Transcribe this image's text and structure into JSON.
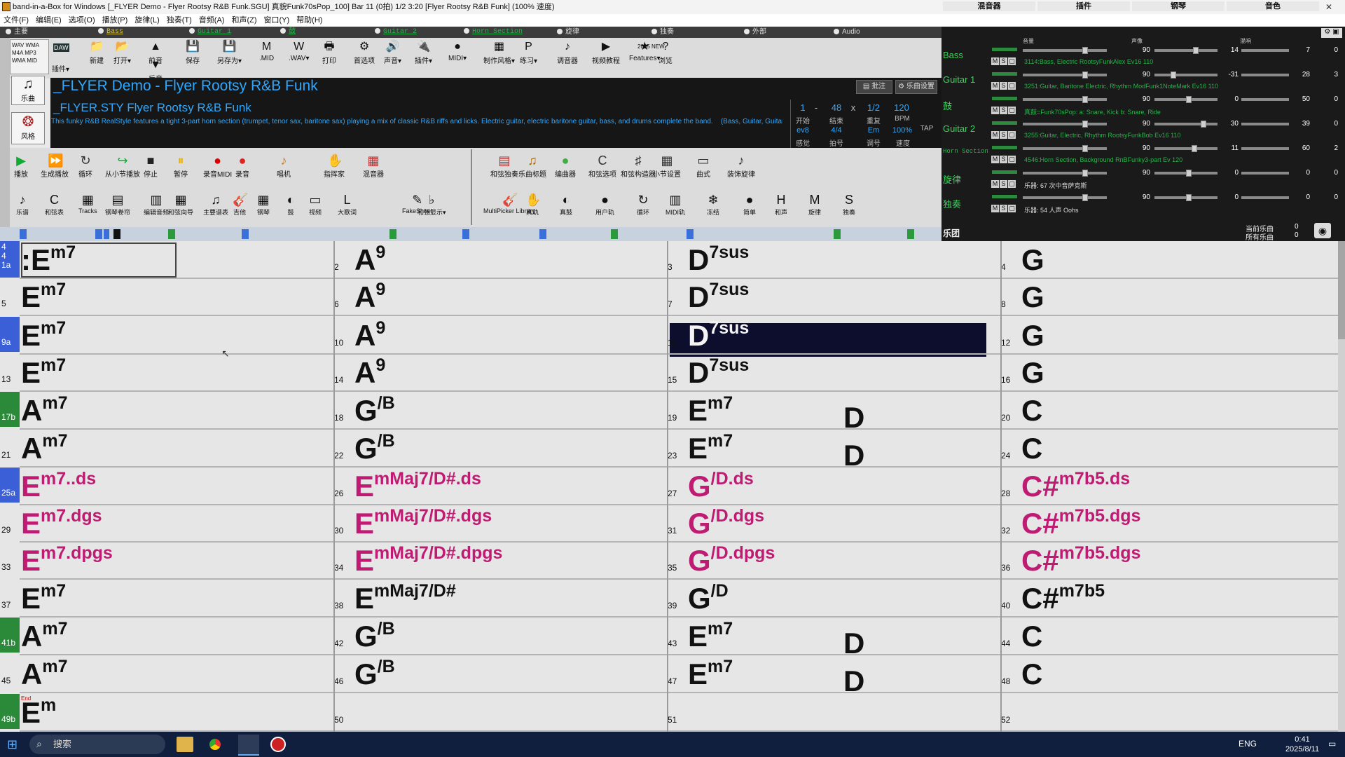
{
  "window": {
    "title": "band-in-a-Box for Windows  [_FLYER Demo - Flyer Rootsy R&B Funk.SGU] 真貌Funk70sPop_100] Bar 11 (0拍) 1/2  3:20 [Flyer Rootsy R&B Funk] (100% 速度)",
    "minimize": "—",
    "maximize": "□",
    "close": "✕"
  },
  "menu": [
    "文件(F)",
    "编辑(E)",
    "选项(O)",
    "播放(P)",
    "旋律(L)",
    "独奏(T)",
    "音频(A)",
    "和声(Z)",
    "窗口(Y)",
    "帮助(H)"
  ],
  "tracks": [
    {
      "label": "主要",
      "mono": false
    },
    {
      "label": "Bass",
      "mono": true,
      "yellow": true
    },
    {
      "label": "Guitar 1",
      "mono": true
    },
    {
      "label": "鼓",
      "mono": true
    },
    {
      "label": "Guitar 2",
      "mono": true
    },
    {
      "label": "Horn Section",
      "mono": true
    },
    {
      "label": "旋律",
      "mono": false
    },
    {
      "label": "独奏",
      "mono": false
    },
    {
      "label": "外部",
      "mono": false
    },
    {
      "label": "Audio",
      "mono": false
    }
  ],
  "toolbar1": {
    "buttons": [
      "新建",
      "打开▾",
      "前音",
      "后音",
      "保存",
      "另存为▾",
      ".MID",
      ".WAV▾",
      "打印",
      "首选项",
      "声音▾",
      "插件▾",
      "MIDI▾",
      "制作风格▾",
      "练习▾",
      "调音器",
      "视频教程",
      "Features▾",
      "浏览"
    ],
    "new_badge": "2025 NEW",
    "daw": "DAW",
    "plugin": "插件▾"
  },
  "side_labels": {
    "songs": "乐曲",
    "styles": "风格"
  },
  "song": {
    "title": "_FLYER Demo - Flyer Rootsy R&B Funk",
    "style": "_FLYER.STY Flyer Rootsy R&B Funk",
    "description": "This funky R&B RealStyle features a tight 3-part horn section (trumpet, tenor sax, baritone sax) playing a mix of classic R&B riffs and licks. Electric guitar, electric baritone guitar, bass, and drums complete the band.",
    "instruments": "(Bass, Guitar, Guitar, Horn Se",
    "notes_btn": "批注",
    "settings_btn": "乐曲设置"
  },
  "info": {
    "start": "1",
    "end": "48",
    "times": "1/2",
    "bpm": "120",
    "loop": "ev8",
    "meter": "4/4",
    "key": "Em",
    "speed": "100%",
    "lab_start": "开始",
    "lab_end": "结束",
    "lab_repeat": "重复",
    "lab_bpm": "BPM",
    "lab_tap": "TAP",
    "lab_feel": "感觉",
    "lab_meter": "拍号",
    "lab_key": "调号",
    "lab_speed": "速度",
    "dash": "-",
    "x": "x"
  },
  "toolbar2": [
    "播放",
    "生成播放",
    "循环",
    "从小节播放",
    "停止",
    "暂停",
    "录音MIDI",
    "录音",
    "唱机",
    "指挥家",
    "混音器",
    "和弦独奏",
    "乐曲标题",
    "编曲器",
    "和弦选项",
    "和弦构造器",
    "小节设置",
    "曲式",
    "装饰旋律"
  ],
  "toolbar3": [
    "乐谱",
    "和弦表",
    "Tracks",
    "钢琴卷帘",
    "编辑音频",
    "和弦向导",
    "主要谱表",
    "吉他",
    "钢琴",
    "鼓",
    "视频",
    "大歌词",
    "FakeSheet",
    "和弦显示▾",
    "MultiPicker Library",
    "真轨",
    "真鼓",
    "用户轨",
    "循环",
    "MIDI轨",
    "冻结",
    "简单",
    "和声",
    "旋律",
    "独奏"
  ],
  "mixer": {
    "tabs": [
      "混音器",
      "插件",
      "钢琴",
      "音色"
    ],
    "col_labels": [
      "音量",
      "声像",
      "混响"
    ],
    "rows": [
      {
        "name": "Bass",
        "patch": "3114:Bass, Electric RootsyFunkAlex Ev16 110",
        "vol": "90",
        "pan": "14",
        "rev": "7",
        "tone": "0"
      },
      {
        "name": "Guitar 1",
        "patch": "3251:Guitar, Baritone Electric, Rhythm ModFunk1NoteMark Ev16 110",
        "vol": "90",
        "pan": "-31",
        "rev": "28",
        "tone": "3"
      },
      {
        "name": "鼓",
        "patch": "真鼓=Funk70sPop: a: Snare, Kick b: Snare, Ride",
        "vol": "90",
        "pan": "0",
        "rev": "50",
        "tone": "0"
      },
      {
        "name": "Guitar 2",
        "patch": "3255:Guitar, Electric, Rhythm RootsyFunkBob Ev16 110",
        "vol": "90",
        "pan": "30",
        "rev": "39",
        "tone": "0"
      },
      {
        "name": "Horn Section",
        "patch": "4546:Horn Section, Background RnBFunky3-part Ev 120",
        "vol": "90",
        "pan": "11",
        "rev": "60",
        "tone": "2"
      },
      {
        "name": "旋律",
        "patch": "乐器: 67 次中音萨克斯",
        "vol": "90",
        "pan": "0",
        "rev": "0",
        "tone": "0"
      },
      {
        "name": "独奏",
        "patch": "乐器: 54 人声 Oohs",
        "vol": "90",
        "pan": "0",
        "rev": "0",
        "tone": "0"
      }
    ],
    "band": "乐团",
    "current_song": "当前乐曲",
    "all_songs": "所有乐曲",
    "cur_val": "0",
    "all_val": "0"
  },
  "sheet": {
    "rows": [
      {
        "label": "4\n4\n1a",
        "marker": "blue",
        "bars": [
          {
            "n": "",
            "root": ":E",
            "ext": "m7"
          },
          {
            "n": "2",
            "root": "A",
            "ext": "9"
          },
          {
            "n": "3",
            "root": "D",
            "ext": "7sus"
          },
          {
            "n": "4",
            "root": "G",
            "ext": ""
          }
        ]
      },
      {
        "label": "5",
        "bars": [
          {
            "n": "",
            "root": "E",
            "ext": "m7"
          },
          {
            "n": "6",
            "root": "A",
            "ext": "9"
          },
          {
            "n": "7",
            "root": "D",
            "ext": "7sus"
          },
          {
            "n": "8",
            "root": "G",
            "ext": ""
          }
        ]
      },
      {
        "label": "9a",
        "marker": "blue",
        "bars": [
          {
            "n": "",
            "root": "E",
            "ext": "m7"
          },
          {
            "n": "10",
            "root": "A",
            "ext": "9"
          },
          {
            "n": "11",
            "root": "D",
            "ext": "7sus",
            "sel": true
          },
          {
            "n": "12",
            "root": "G",
            "ext": ""
          }
        ]
      },
      {
        "label": "13",
        "bars": [
          {
            "n": "",
            "root": "E",
            "ext": "m7"
          },
          {
            "n": "14",
            "root": "A",
            "ext": "9"
          },
          {
            "n": "15",
            "root": "D",
            "ext": "7sus"
          },
          {
            "n": "16",
            "root": "G",
            "ext": ""
          }
        ]
      },
      {
        "label": "17b",
        "marker": "green",
        "bars": [
          {
            "n": "",
            "root": "A",
            "ext": "m7"
          },
          {
            "n": "18",
            "root": "G",
            "ext": "/B"
          },
          {
            "n": "19",
            "root": "E",
            "ext": "m7",
            "root2": "D"
          },
          {
            "n": "20",
            "root": "C",
            "ext": ""
          }
        ]
      },
      {
        "label": "21",
        "bars": [
          {
            "n": "",
            "root": "A",
            "ext": "m7"
          },
          {
            "n": "22",
            "root": "G",
            "ext": "/B"
          },
          {
            "n": "23",
            "root": "E",
            "ext": "m7",
            "root2": "D"
          },
          {
            "n": "24",
            "root": "C",
            "ext": ""
          }
        ]
      },
      {
        "label": "25a",
        "marker": "blue",
        "pink": true,
        "bars": [
          {
            "n": "",
            "root": "E",
            "ext": "m7..ds"
          },
          {
            "n": "26",
            "root": "E",
            "ext": "mMaj7/D#.ds"
          },
          {
            "n": "27",
            "root": "G",
            "ext": "/D.ds"
          },
          {
            "n": "28",
            "root": "C#",
            "ext": "m7b5.ds"
          }
        ]
      },
      {
        "label": "29",
        "pink": true,
        "bars": [
          {
            "n": "",
            "root": "E",
            "ext": "m7.dgs"
          },
          {
            "n": "30",
            "root": "E",
            "ext": "mMaj7/D#.dgs"
          },
          {
            "n": "31",
            "root": "G",
            "ext": "/D.dgs"
          },
          {
            "n": "32",
            "root": "C#",
            "ext": "m7b5.dgs"
          }
        ]
      },
      {
        "label": "33",
        "pink": true,
        "bars": [
          {
            "n": "",
            "root": "E",
            "ext": "m7.dpgs"
          },
          {
            "n": "34",
            "root": "E",
            "ext": "mMaj7/D#.dpgs"
          },
          {
            "n": "35",
            "root": "G",
            "ext": "/D.dpgs"
          },
          {
            "n": "36",
            "root": "C#",
            "ext": "m7b5.dgs"
          }
        ]
      },
      {
        "label": "37",
        "bars": [
          {
            "n": "",
            "root": "E",
            "ext": "m7"
          },
          {
            "n": "38",
            "root": "E",
            "ext": "mMaj7/D#"
          },
          {
            "n": "39",
            "root": "G",
            "ext": "/D"
          },
          {
            "n": "40",
            "root": "C#",
            "ext": "m7b5"
          }
        ]
      },
      {
        "label": "41b",
        "marker": "green",
        "bars": [
          {
            "n": "",
            "root": "A",
            "ext": "m7"
          },
          {
            "n": "42",
            "root": "G",
            "ext": "/B"
          },
          {
            "n": "43",
            "root": "E",
            "ext": "m7",
            "root2": "D"
          },
          {
            "n": "44",
            "root": "C",
            "ext": ""
          }
        ]
      },
      {
        "label": "45",
        "bars": [
          {
            "n": "",
            "root": "A",
            "ext": "m7"
          },
          {
            "n": "46",
            "root": "G",
            "ext": "/B"
          },
          {
            "n": "47",
            "root": "E",
            "ext": "m7",
            "root2": "D"
          },
          {
            "n": "48",
            "root": "C",
            "ext": ""
          }
        ]
      },
      {
        "label": "49b",
        "marker": "green",
        "bars": [
          {
            "n": "",
            "root": "E",
            "ext": "m"
          },
          {
            "n": "50",
            "root": "",
            "ext": ""
          },
          {
            "n": "51",
            "root": "",
            "ext": ""
          },
          {
            "n": "52",
            "root": "",
            "ext": ""
          }
        ]
      }
    ],
    "end_marker": "End"
  },
  "taskbar": {
    "search": "搜索",
    "lang": "ENG",
    "time": "0:41",
    "date": "2025/8/11"
  },
  "colors": {
    "accent": "#2ea8ff",
    "chord_pink": "#c01b72",
    "selected": "#0d0d2e",
    "mixer_green": "#3bd35a"
  }
}
